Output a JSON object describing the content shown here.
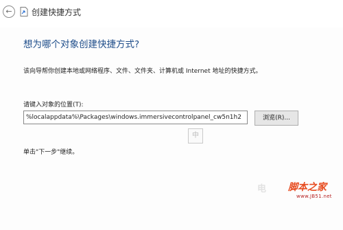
{
  "window": {
    "title": "创建快捷方式"
  },
  "wizard": {
    "heading": "想为哪个对象创建快捷方式?",
    "description": "该向导帮你创建本地或网络程序、文件、文件夹、计算机或 Internet 地址的快捷方式。",
    "location_label": "请键入对象的位置(T):",
    "location_value": "%localappdata%\\Packages\\windows.immersivecontrolpanel_cw5n1h2",
    "browse_label": "浏览(R)...",
    "hint": "单击\"下一步\"继续。"
  },
  "ime": {
    "mode_char": "中"
  },
  "watermark": {
    "left_text": "电",
    "logo_text": "脚本之家",
    "url": "www.JB51.net"
  },
  "colors": {
    "heading": "#1e4d8a",
    "watermark_red": "#d92b1c"
  }
}
